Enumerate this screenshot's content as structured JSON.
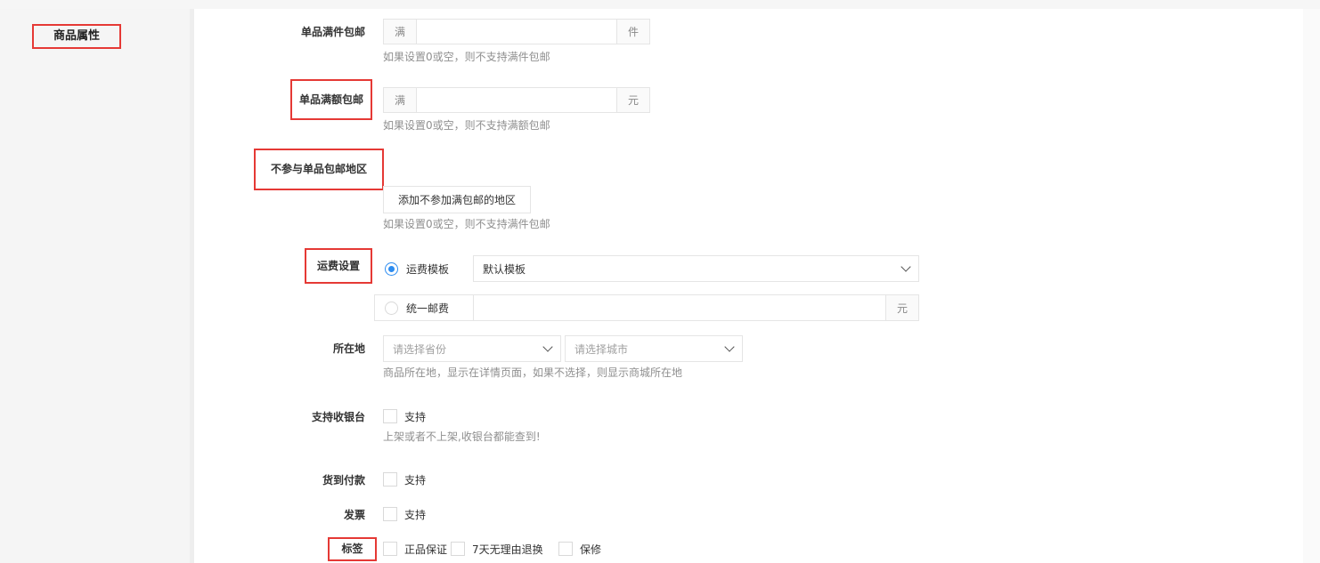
{
  "sidebar": {
    "title": "商品属性"
  },
  "fields": {
    "free_ship_count": {
      "label": "单品满件包邮",
      "prefix": "满",
      "suffix": "件",
      "value": "",
      "help": "如果设置0或空，则不支持满件包邮"
    },
    "free_ship_amount": {
      "label": "单品满额包邮",
      "prefix": "满",
      "suffix": "元",
      "value": "",
      "help": "如果设置0或空，则不支持满额包邮"
    },
    "excluded_regions": {
      "label": "不参与单品包邮地区",
      "button": "添加不参加满包邮的地区",
      "help": "如果设置0或空，则不支持满件包邮"
    },
    "shipping": {
      "label": "运费设置",
      "option_template": "运费模板",
      "template_value": "默认模板",
      "option_uniform": "统一邮费",
      "uniform_value": "",
      "uniform_suffix": "元"
    },
    "location": {
      "label": "所在地",
      "province_placeholder": "请选择省份",
      "city_placeholder": "请选择城市",
      "help": "商品所在地，显示在详情页面，如果不选择，则显示商城所在地"
    },
    "cashier": {
      "label": "支持收银台",
      "option": "支持",
      "help": "上架或者不上架,收银台都能查到!"
    },
    "cod": {
      "label": "货到付款",
      "option": "支持"
    },
    "invoice": {
      "label": "发票",
      "option": "支持"
    },
    "tags": {
      "label": "标签",
      "options": [
        "正品保证",
        "7天无理由退换",
        "保修"
      ]
    }
  },
  "colors": {
    "accent": "#2d8cf0",
    "highlight_box": "#e53935",
    "help_text": "#8f8f8f"
  }
}
